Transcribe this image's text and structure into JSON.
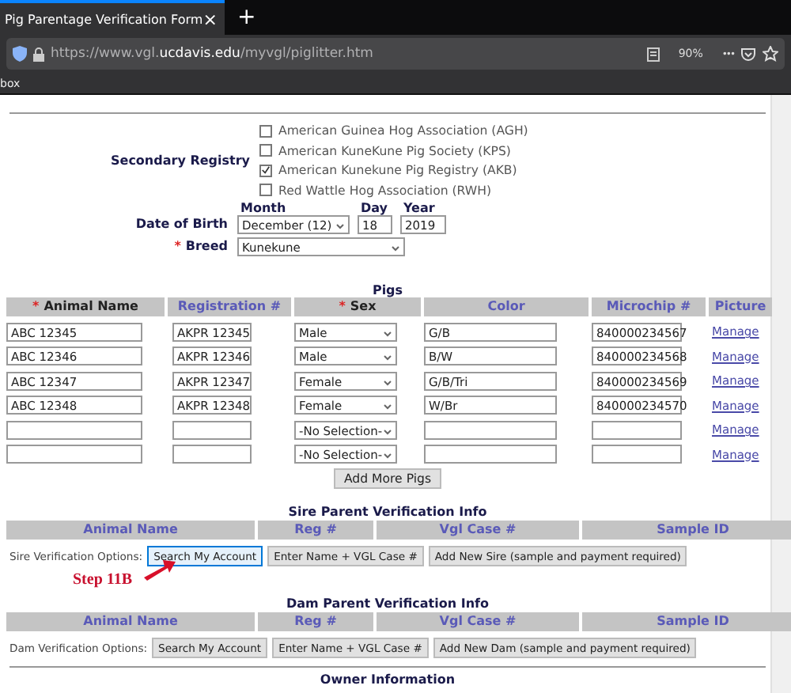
{
  "browser": {
    "tab_title": "Pig Parentage Verification Form",
    "tab_close": "×",
    "new_tab": "+",
    "url_prefix": "https://www.vgl.",
    "url_domain": "ucdavis.edu",
    "url_path": "/myvgl/piglitter.htm",
    "zoom": "90%",
    "more": "•••",
    "bookmark": "box"
  },
  "required_mark": "*",
  "form": {
    "secondary_registry": {
      "label": "Secondary Registry",
      "options": [
        {
          "label": "American Guinea Hog Association (AGH)",
          "checked": false
        },
        {
          "label": "American KuneKune Pig Society (KPS)",
          "checked": false
        },
        {
          "label": "American Kunekune Pig Registry (AKB)",
          "checked": true
        },
        {
          "label": "Red Wattle Hog Association (RWH)",
          "checked": false
        }
      ]
    },
    "date_of_birth": {
      "label": "Date of Birth",
      "month_label": "Month",
      "day_label": "Day",
      "year_label": "Year",
      "month": "December (12)",
      "day": "18",
      "year": "2019"
    },
    "breed": {
      "label": "Breed",
      "required": true,
      "value": "Kunekune"
    }
  },
  "pigs": {
    "title": "Pigs",
    "columns": [
      {
        "label": "Animal Name",
        "required": true
      },
      {
        "label": "Registration #",
        "required": false
      },
      {
        "label": "Sex",
        "required": true
      },
      {
        "label": "Color",
        "required": false
      },
      {
        "label": "Microchip #",
        "required": false
      },
      {
        "label": "Picture",
        "required": false
      }
    ],
    "rows": [
      {
        "name": "ABC 12345",
        "registration": "AKPR 12345",
        "sex": "Male",
        "coat": "G/B",
        "microchip": "840000234567",
        "picture": "Manage"
      },
      {
        "name": "ABC 12346",
        "registration": "AKPR 12346",
        "sex": "Male",
        "coat": "B/W",
        "microchip": "840000234568",
        "picture": "Manage"
      },
      {
        "name": "ABC 12347",
        "registration": "AKPR 12347",
        "sex": "Female",
        "coat": "G/B/Tri",
        "microchip": "840000234569",
        "picture": "Manage"
      },
      {
        "name": "ABC 12348",
        "registration": "AKPR 12348",
        "sex": "Female",
        "coat": "W/Br",
        "microchip": "840000234570",
        "picture": "Manage"
      },
      {
        "name": "",
        "registration": "",
        "sex": "-No Selection-",
        "coat": "",
        "microchip": "",
        "picture": "Manage"
      },
      {
        "name": "",
        "registration": "",
        "sex": "-No Selection-",
        "coat": "",
        "microchip": "",
        "picture": "Manage"
      }
    ],
    "add_button": "Add More Pigs"
  },
  "sire": {
    "title": "Sire Parent Verification Info",
    "columns": [
      "Animal Name",
      "Reg #",
      "Vgl Case #",
      "Sample ID"
    ],
    "options_label": "Sire Verification Options:",
    "buttons": [
      {
        "label": "Search My Account",
        "focused": true
      },
      {
        "label": "Enter Name + VGL Case #",
        "focused": false
      },
      {
        "label": "Add New Sire (sample and payment required)",
        "focused": false
      }
    ],
    "annotation": "Step 11B"
  },
  "dam": {
    "title": "Dam Parent Verification Info",
    "columns": [
      "Animal Name",
      "Reg #",
      "Vgl Case #",
      "Sample ID"
    ],
    "options_label": "Dam Verification Options:",
    "buttons": [
      {
        "label": "Search My Account",
        "focused": false
      },
      {
        "label": "Enter Name + VGL Case #",
        "focused": false
      },
      {
        "label": "Add New Dam (sample and payment required)",
        "focused": false
      }
    ]
  },
  "owner_title": "Owner Information"
}
